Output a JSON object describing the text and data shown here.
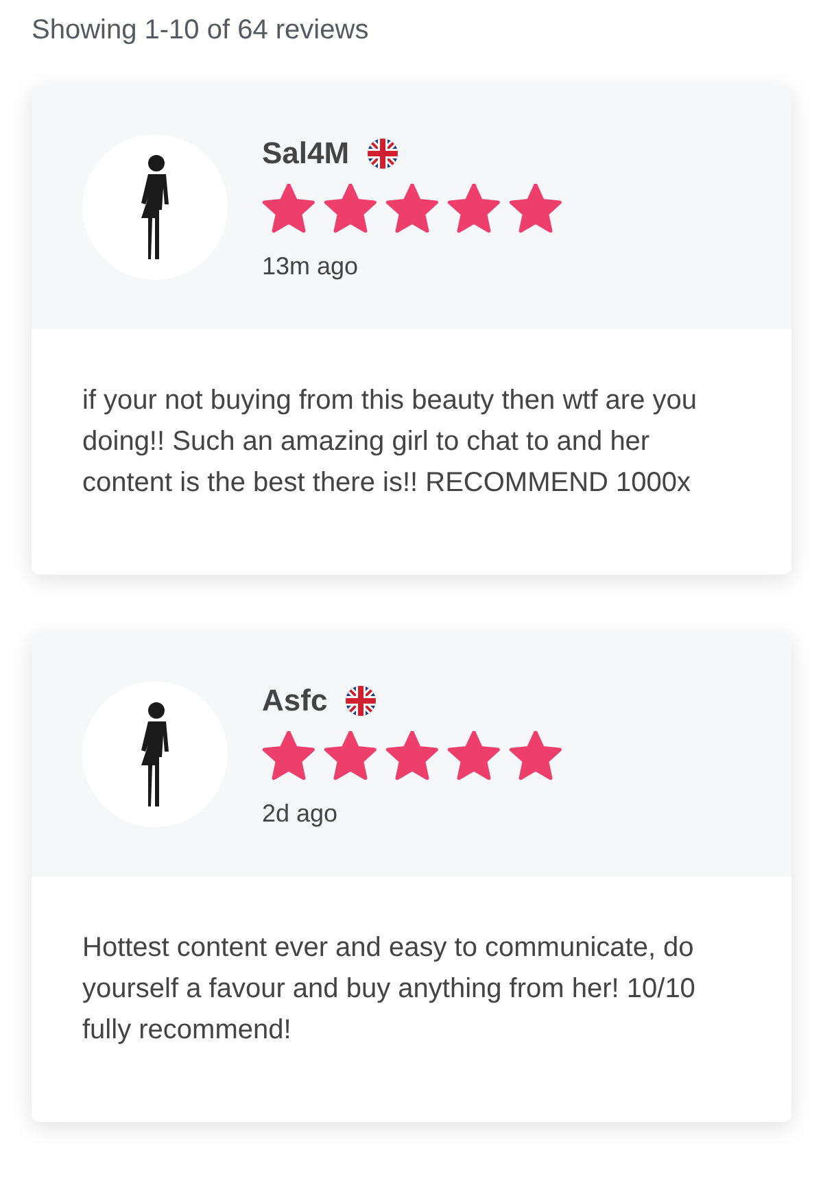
{
  "summary": "Showing 1-10 of 64 reviews",
  "reviews": [
    {
      "name": "Sal4M",
      "stars": 5,
      "time": "13m ago",
      "text": "if your not buying from this beauty then wtf are you doing!! Such an amazing girl to chat to and her content is the best there is!! RECOMMEND 1000x"
    },
    {
      "name": "Asfc",
      "stars": 5,
      "time": "2d ago",
      "text": "Hottest content ever and easy to communicate, do yourself a favour and buy anything from her! 10/10 fully recommend!"
    }
  ]
}
